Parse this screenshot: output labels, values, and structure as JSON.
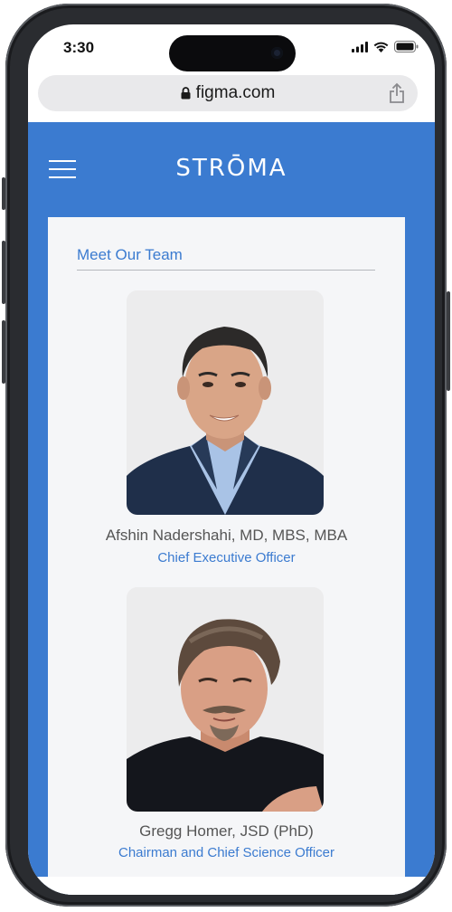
{
  "status_bar": {
    "time": "3:30",
    "signal_icon": "cellular-signal-icon",
    "wifi_icon": "wifi-icon",
    "battery_icon": "battery-icon"
  },
  "browser": {
    "url": "figma.com",
    "lock_icon": "lock-icon",
    "share_icon": "share-icon"
  },
  "header": {
    "menu_icon": "hamburger-menu-icon",
    "logo": "STRŌMA"
  },
  "colors": {
    "brand_blue": "#3b7bd0",
    "card_bg": "#f5f6f8",
    "name_text": "#555555"
  },
  "team": {
    "title": "Meet Our Team",
    "members": [
      {
        "name": "Afshin Nadershahi, MD, MBS, MBA",
        "role": "Chief Executive Officer"
      },
      {
        "name": "Gregg Homer, JSD (PhD)",
        "role": "Chairman and Chief Science Officer"
      }
    ]
  }
}
